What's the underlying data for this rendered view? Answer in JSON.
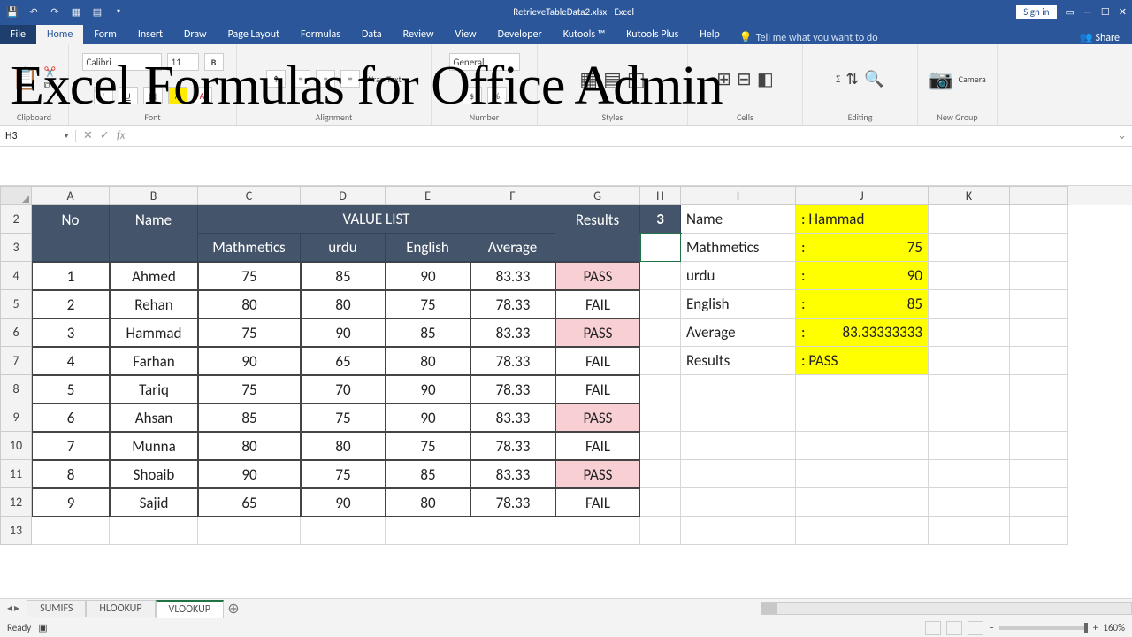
{
  "window": {
    "title": "RetrieveTableData2.xlsx - Excel",
    "signin": "Sign in"
  },
  "tabs": {
    "file": "File",
    "home": "Home",
    "form": "Form",
    "insert": "Insert",
    "draw": "Draw",
    "pagelayout": "Page Layout",
    "formulas": "Formulas",
    "data": "Data",
    "review": "Review",
    "view": "View",
    "developer": "Developer",
    "kutools": "Kutools ™",
    "kutoolsplus": "Kutools Plus",
    "help": "Help",
    "tellme": "Tell me what you want to do",
    "share": "Share"
  },
  "ribbon": {
    "font_name": "Calibri",
    "font_size": "11",
    "wrap": "Wrap Text",
    "general": "General",
    "camera": "Camera",
    "groups": {
      "clipboard": "Clipboard",
      "font": "Font",
      "alignment": "Alignment",
      "number": "Number",
      "styles": "Styles",
      "cells": "Cells",
      "editing": "Editing",
      "newgroup": "New Group"
    }
  },
  "overlay": "Excel Formulas for Office Admin",
  "namebox": "H3",
  "fx": "fx",
  "columns": [
    "A",
    "B",
    "C",
    "D",
    "E",
    "F",
    "G",
    "H",
    "I",
    "J",
    "K"
  ],
  "rownums": [
    "2",
    "3",
    "4",
    "5",
    "6",
    "7",
    "8",
    "9",
    "10",
    "11",
    "12",
    "13"
  ],
  "tbl": {
    "no": "No",
    "name": "Name",
    "valuelist": "VALUE LIST",
    "results": "Results",
    "math": "Mathmetics",
    "urdu": "urdu",
    "english": "English",
    "avg": "Average",
    "rows": [
      {
        "n": "1",
        "name": "Ahmed",
        "m": "75",
        "u": "85",
        "e": "90",
        "a": "83.33",
        "r": "PASS",
        "pass": true
      },
      {
        "n": "2",
        "name": "Rehan",
        "m": "80",
        "u": "80",
        "e": "75",
        "a": "78.33",
        "r": "FAIL",
        "pass": false
      },
      {
        "n": "3",
        "name": "Hammad",
        "m": "75",
        "u": "90",
        "e": "85",
        "a": "83.33",
        "r": "PASS",
        "pass": true
      },
      {
        "n": "4",
        "name": "Farhan",
        "m": "90",
        "u": "65",
        "e": "80",
        "a": "78.33",
        "r": "FAIL",
        "pass": false
      },
      {
        "n": "5",
        "name": "Tariq",
        "m": "75",
        "u": "70",
        "e": "90",
        "a": "78.33",
        "r": "FAIL",
        "pass": false
      },
      {
        "n": "6",
        "name": "Ahsan",
        "m": "85",
        "u": "75",
        "e": "90",
        "a": "83.33",
        "r": "PASS",
        "pass": true
      },
      {
        "n": "7",
        "name": "Munna",
        "m": "80",
        "u": "80",
        "e": "75",
        "a": "78.33",
        "r": "FAIL",
        "pass": false
      },
      {
        "n": "8",
        "name": "Shoaib",
        "m": "90",
        "u": "75",
        "e": "85",
        "a": "83.33",
        "r": "PASS",
        "pass": true
      },
      {
        "n": "9",
        "name": "Sajid",
        "m": "65",
        "u": "90",
        "e": "80",
        "a": "78.33",
        "r": "FAIL",
        "pass": false
      }
    ]
  },
  "lookup": {
    "key": "3",
    "labels": {
      "name": "Name",
      "math": "Mathmetics",
      "urdu": "urdu",
      "english": "English",
      "avg": "Average",
      "results": "Results"
    },
    "colon": ":",
    "vals": {
      "name": "Hammad",
      "math": "75",
      "urdu": "90",
      "english": "85",
      "avg": "83.33333333",
      "results": "PASS"
    }
  },
  "sheets": {
    "s1": "SUMIFS",
    "s2": "HLOOKUP",
    "s3": "VLOOKUP"
  },
  "status": {
    "ready": "Ready",
    "zoom": "160%"
  }
}
